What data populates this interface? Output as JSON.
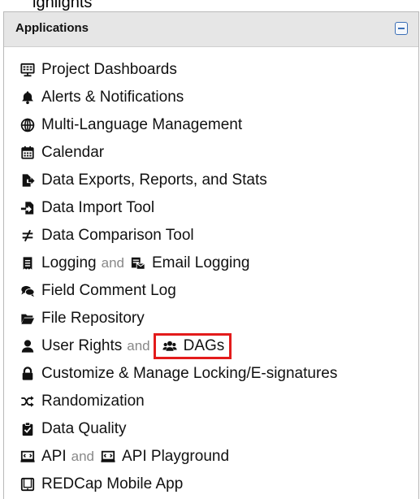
{
  "top_cut_text": "ighlights",
  "panel": {
    "title": "Applications",
    "items": [
      {
        "label": "Project Dashboards",
        "icon": "dashboard-screen-icon"
      },
      {
        "label": "Alerts & Notifications",
        "icon": "bell-icon"
      },
      {
        "label": "Multi-Language Management",
        "icon": "globe-icon"
      },
      {
        "label": "Calendar",
        "icon": "calendar-icon"
      },
      {
        "label": "Data Exports, Reports, and Stats",
        "icon": "file-export-icon"
      },
      {
        "label": "Data Import Tool",
        "icon": "file-import-icon"
      },
      {
        "label": "Data Comparison Tool",
        "icon": "not-equal-icon"
      },
      {
        "label": "Logging",
        "connector": "and",
        "label2": "Email Logging",
        "icon": "receipt-icon",
        "icon2": "mail-log-icon"
      },
      {
        "label": "Field Comment Log",
        "icon": "comments-icon"
      },
      {
        "label": "File Repository",
        "icon": "folder-open-icon"
      },
      {
        "label": "User Rights",
        "connector": "and",
        "label2": "DAGs",
        "icon": "user-icon",
        "icon2": "users-group-icon",
        "highlight": "DAGs"
      },
      {
        "label": "Customize & Manage Locking/E-signatures",
        "icon": "lock-icon"
      },
      {
        "label": "Randomization",
        "icon": "shuffle-icon"
      },
      {
        "label": "Data Quality",
        "icon": "clipboard-check-icon"
      },
      {
        "label": "API",
        "connector": "and",
        "label2": "API Playground",
        "icon": "api-laptop-icon",
        "icon2": "api-laptop-icon"
      },
      {
        "label": "REDCap Mobile App",
        "icon": "tablet-icon"
      }
    ]
  },
  "colors": {
    "header_bg": "#e6e6e6",
    "highlight_border": "#e31b1b",
    "collapse_icon": "#3b6fb6"
  }
}
